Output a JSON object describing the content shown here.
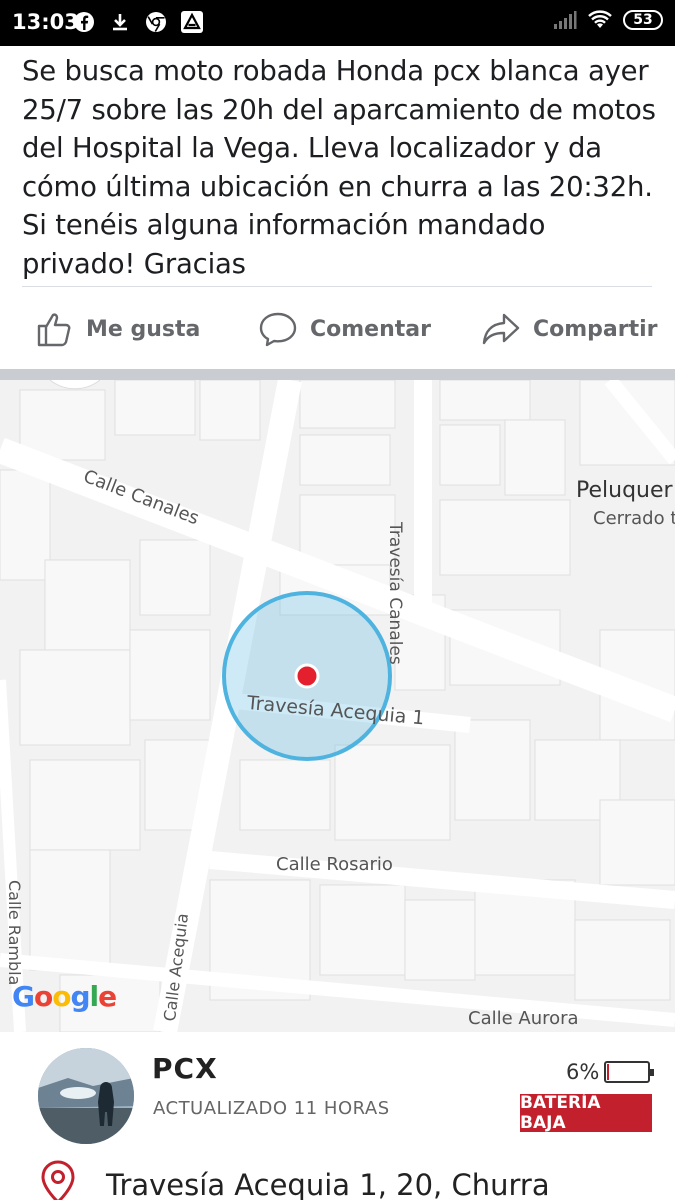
{
  "status_bar": {
    "time": "13:03",
    "left_icons": [
      "facebook-icon",
      "download-icon",
      "chrome-icon",
      "app-icon"
    ],
    "battery_level": "53"
  },
  "post": {
    "text": "Se busca moto robada Honda pcx blanca ayer 25/7  sobre las 20h del aparcamiento de motos del Hospital la Vega. Lleva localizador y da cómo última ubicación en churra a las 20:32h. Si tenéis alguna información mandado privado! Gracias",
    "actions": {
      "like": "Me gusta",
      "comment": "Comentar",
      "share": "Compartir"
    }
  },
  "map": {
    "streets": {
      "calle_canales": "Calle Canales",
      "travesia_canales": "Travesía Canales",
      "travesia_acequia": "Travesía Acequia 1",
      "calle_rosario": "Calle Rosario",
      "calle_rambla": "Calle Rambla",
      "calle_acequia": "Calle Acequia",
      "calle_aurora": "Calle Aurora"
    },
    "poi_name": "Peluquer",
    "poi_status": "Cerrado t",
    "attribution": "Google",
    "accuracy_color": "#4fb3e0",
    "marker_color": "#e5202e"
  },
  "tracker": {
    "device_name": "PCX",
    "updated": "ACTUALIZADO 11 HORAS",
    "battery_percent": "6%",
    "battery_fraction": 0.06,
    "battery_badge": "BATERÍA BAJA",
    "address": "Travesía Acequia 1, 20, Churra",
    "alert_color": "#c3202d"
  }
}
